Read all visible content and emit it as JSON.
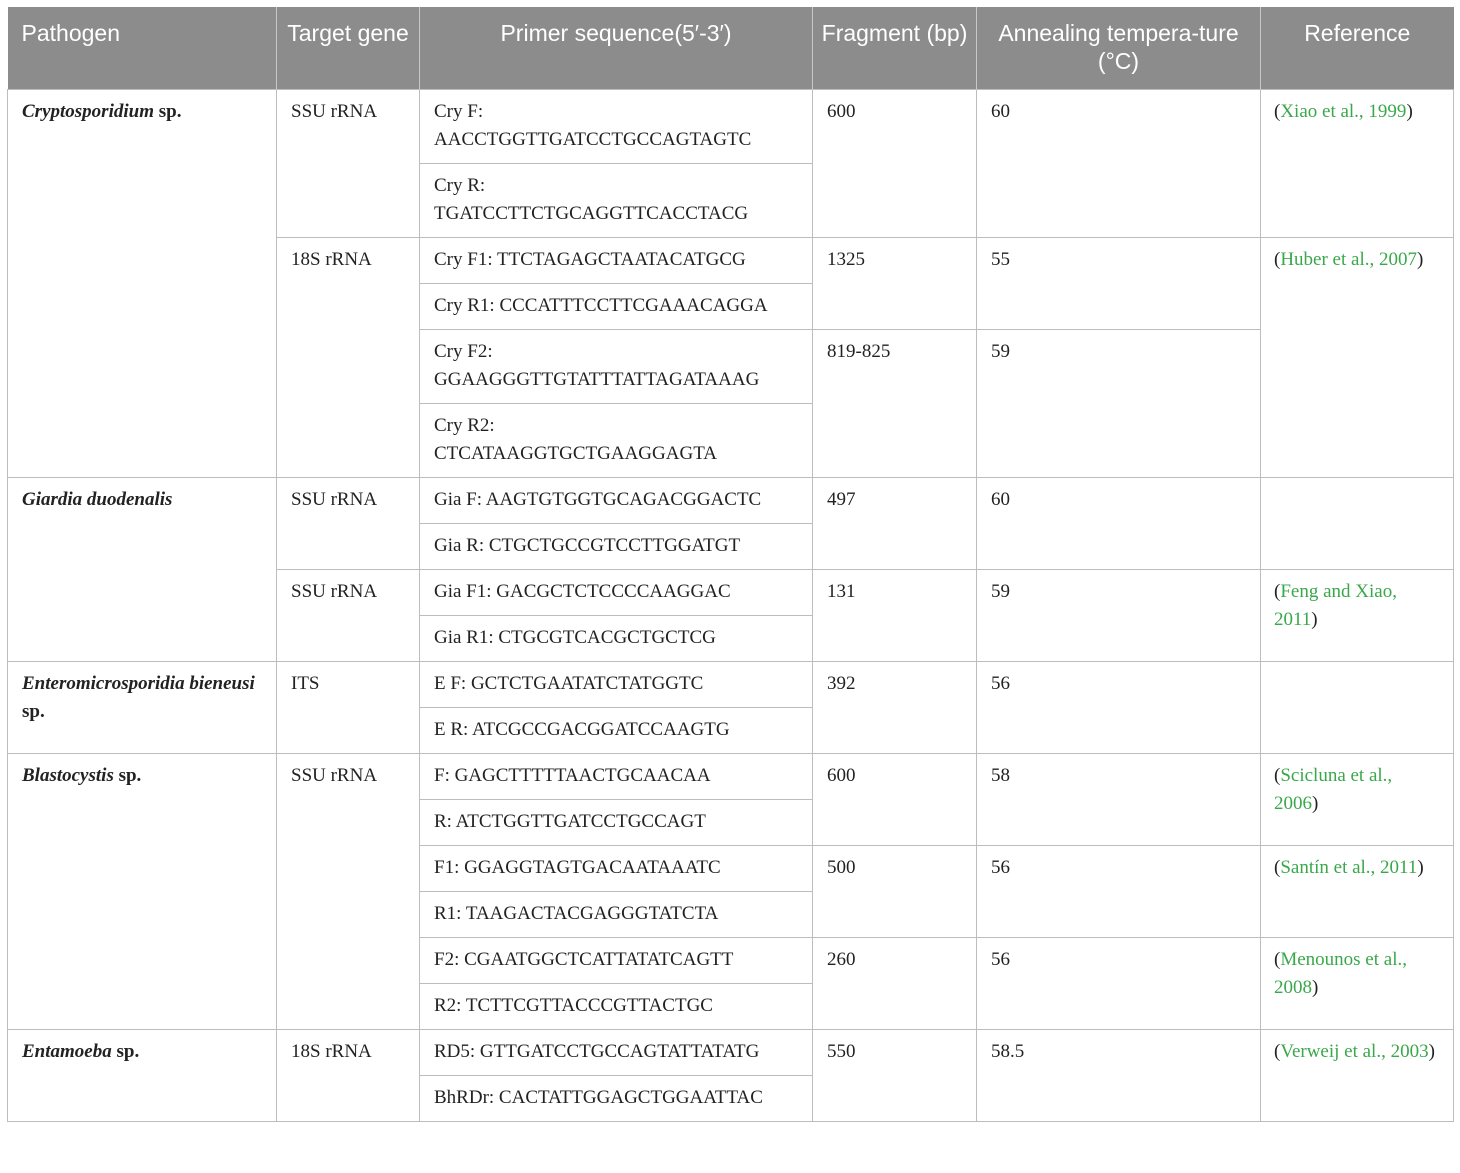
{
  "headers": {
    "pathogen": "Pathogen",
    "target_gene": "Target gene",
    "primer": "Primer sequence(5′-3′)",
    "fragment": "Fragment (bp)",
    "annealing": "Annealing tempera-ture (°C)",
    "reference": "Reference"
  },
  "rows": {
    "r1": {
      "pathogen_genus": "Cryptosporidium",
      "pathogen_suffix": " sp.",
      "gene": "SSU rRNA",
      "p1_a": "Cry F:",
      "p1_b": "AACCTGGTTGATCCTGCCAGTAGTC",
      "p2_a": "Cry R:",
      "p2_b": "TGATCCTTCTGCAGGTTCACCTACG",
      "fragment": "600",
      "annealing": "60",
      "reference": "Xiao et al., 1999"
    },
    "r2": {
      "gene": "18S rRNA",
      "p1": "Cry F1: TTCTAGAGCTAATACATGCG",
      "p2": "Cry R1: CCCATTTCCTTCGAAACAGGA",
      "fragment_a": "1325",
      "annealing_a": "55",
      "p3_a": "Cry F2:",
      "p3_b": "GGAAGGGTTGTATTTATTAGATAAAG",
      "p4_a": "Cry R2:",
      "p4_b": "CTCATAAGGTGCTGAAGGAGTA",
      "fragment_b": "819-825",
      "annealing_b": "59",
      "reference": "Huber et al., 2007"
    },
    "r3": {
      "pathogen_genus": "Giardia duodenalis",
      "gene": "SSU rRNA",
      "p1": "Gia F: AAGTGTGGTGCAGACGGACTC",
      "p2": "Gia R: CTGCTGCCGTCCTTGGATGT",
      "fragment": "497",
      "annealing": "60"
    },
    "r4": {
      "gene": "SSU rRNA",
      "p1": "Gia F1: GACGCTCTCCCCAAGGAC",
      "p2": "Gia R1: CTGCGTCACGCTGCTCG",
      "fragment": "131",
      "annealing": "59",
      "reference": "Feng and Xiao, 2011"
    },
    "r5": {
      "pathogen_genus": "Enteromicrosporidia bieneusi",
      "pathogen_suffix": " sp.",
      "gene": "ITS",
      "p1": "E F: GCTCTGAATATCTATGGTC",
      "p2": "E R: ATCGCCGACGGATCCAAGTG",
      "fragment": "392",
      "annealing": "56"
    },
    "r6": {
      "pathogen_genus": "Blastocystis",
      "pathogen_suffix": " sp.",
      "gene": "SSU rRNA",
      "p1": "F: GAGCTTTTTAACTGCAACAA",
      "p2": "R: ATCTGGTTGATCCTGCCAGT",
      "fragment_a": "600",
      "annealing_a": "58",
      "reference_a": "Scicluna et al., 2006",
      "p3": "F1: GGAGGTAGTGACAATAAATC",
      "p4": "R1: TAAGACTACGAGGGTATCTA",
      "fragment_b": "500",
      "annealing_b": "56",
      "reference_b": "Santín et al., 2011",
      "p5": "F2: CGAATGGCTCATTATATCAGTT",
      "p6": "R2: TCTTCGTTACCCGTTACTGC",
      "fragment_c": "260",
      "annealing_c": "56",
      "reference_c": "Menounos et al., 2008"
    },
    "r7": {
      "pathogen_genus": "Entamoeba",
      "pathogen_suffix": " sp.",
      "gene": "18S rRNA",
      "p1": "RD5: GTTGATCCTGCCAGTATTATATG",
      "p2": "BhRDr: CACTATTGGAGCTGGAATTAC",
      "fragment": "550",
      "annealing": "58.5",
      "reference": "Verweij et al., 2003"
    }
  },
  "colors": {
    "header_bg": "#8c8c8c",
    "link": "#3aa84a",
    "border": "#bdbdbd"
  }
}
